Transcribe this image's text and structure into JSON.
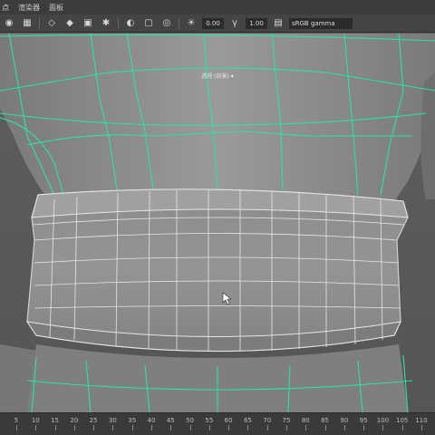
{
  "colors": {
    "wire_green": "#2de0a8",
    "wire_white": "#e6e6e6",
    "mesh_shade": "#8a8a8a",
    "background": "#5a5a5a"
  },
  "menu": {
    "items": [
      "点",
      "渲染器",
      "面板"
    ]
  },
  "toolbar": {
    "icons": [
      "camera-icon",
      "grid-icon",
      "wireframe-icon",
      "smooth-shade-icon",
      "texture-icon",
      "light-icon",
      "shadow-icon",
      "isolate-icon",
      "xray-icon",
      "gamma-icon"
    ],
    "exposure": "0.00",
    "gamma": "1.00",
    "color_space": "sRGB gamma"
  },
  "viewport": {
    "camera_label": "透视 (前景) ▾",
    "axis_label": "persp"
  },
  "timeline": {
    "ticks": [
      "5",
      "10",
      "15",
      "20",
      "25",
      "30",
      "35",
      "40",
      "45",
      "50",
      "55",
      "60",
      "65",
      "70",
      "75",
      "80",
      "85",
      "90",
      "95",
      "100",
      "105",
      "110"
    ]
  }
}
